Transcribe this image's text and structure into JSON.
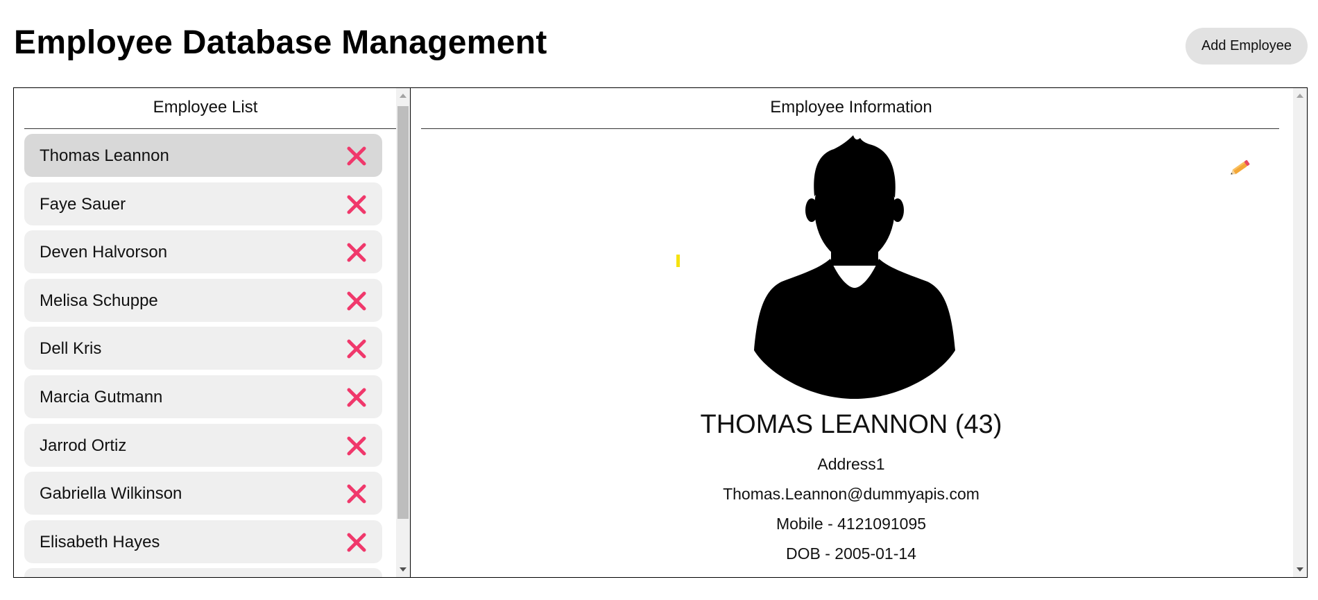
{
  "page": {
    "title": "Employee Database Management",
    "add_button_label": "Add Employee"
  },
  "employee_list": {
    "heading": "Employee List",
    "items": [
      {
        "name": "Thomas Leannon",
        "selected": true
      },
      {
        "name": "Faye Sauer"
      },
      {
        "name": "Deven Halvorson"
      },
      {
        "name": "Melisa Schuppe"
      },
      {
        "name": "Dell Kris"
      },
      {
        "name": "Marcia Gutmann"
      },
      {
        "name": "Jarrod Ortiz"
      },
      {
        "name": "Gabriella Wilkinson"
      },
      {
        "name": "Elisabeth Hayes"
      },
      {
        "name": ""
      }
    ]
  },
  "employee_info": {
    "heading": "Employee Information",
    "name_line": "THOMAS LEANNON (43)",
    "address": "Address1",
    "email": "Thomas.Leannon@dummyapis.com",
    "mobile": "Mobile - 4121091095",
    "dob": "DOB - 2005-01-14"
  },
  "icons": {
    "delete": "close-x-icon",
    "edit": "pencil-icon",
    "avatar": "person-silhouette-icon"
  },
  "colors": {
    "delete": "#f0386b",
    "item_background": "#efefef",
    "item_selected": "#d8d8d8",
    "add_button": "#e2e2e2",
    "pencil_body": "#f4a736",
    "pencil_eraser": "#e84a5f",
    "cursor": "#f5e20f"
  }
}
